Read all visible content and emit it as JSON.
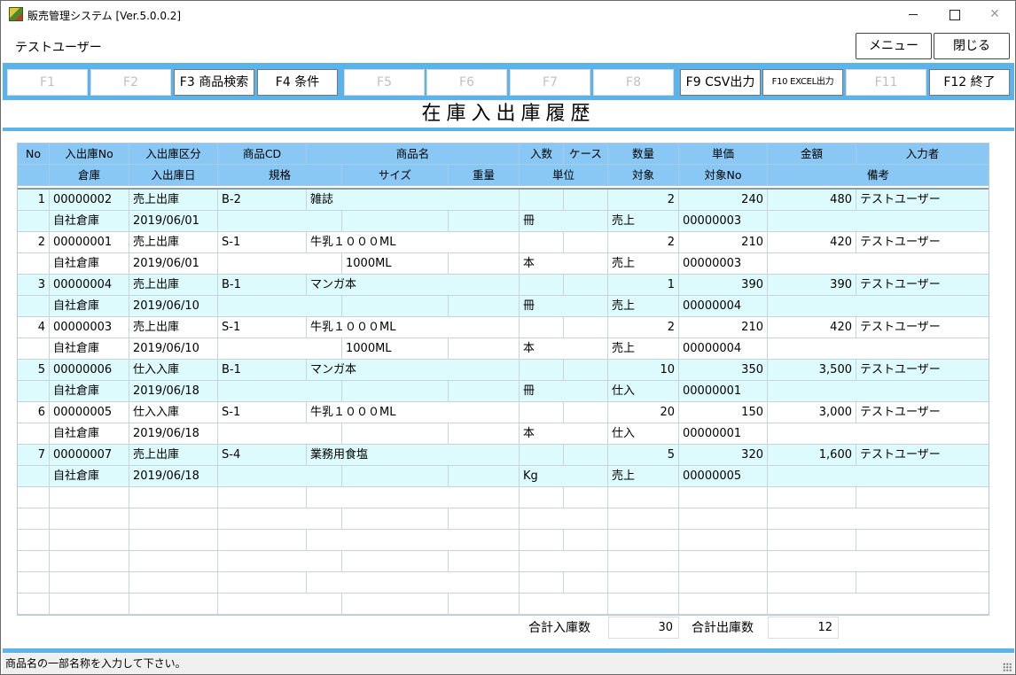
{
  "window": {
    "title": "販売管理システム [Ver.5.0.0.2]",
    "min_glyph": "",
    "max_glyph": "",
    "close_glyph": "✕"
  },
  "user": {
    "name": "テストユーザー"
  },
  "top_buttons": {
    "menu": "メニュー",
    "close": "閉じる"
  },
  "fkeys": [
    {
      "label": "F1",
      "enabled": false
    },
    {
      "label": "F2",
      "enabled": false
    },
    {
      "label": "F3 商品検索",
      "enabled": true
    },
    {
      "label": "F4 条件",
      "enabled": true
    },
    {
      "label": "F5",
      "enabled": false
    },
    {
      "label": "F6",
      "enabled": false
    },
    {
      "label": "F7",
      "enabled": false
    },
    {
      "label": "F8",
      "enabled": false
    },
    {
      "label": "F9 CSV出力",
      "enabled": true
    },
    {
      "label": "F10 EXCEL出力",
      "enabled": true
    },
    {
      "label": "F11",
      "enabled": false
    },
    {
      "label": "F12 終了",
      "enabled": true
    }
  ],
  "page_title": "在庫入出庫履歴",
  "grid": {
    "header_row1": [
      "No",
      "入出庫No",
      "入出庫区分",
      "商品CD",
      "商品名",
      "入数",
      "ケース",
      "数量",
      "単価",
      "金額",
      "入力者"
    ],
    "header_row2": [
      "倉庫",
      "入出庫日",
      "規格",
      "サイズ",
      "重量",
      "単位",
      "対象",
      "対象No",
      "備考"
    ],
    "records": [
      {
        "no": "1",
        "io_no": "00000002",
        "kubun": "売上出庫",
        "cd": "B-2",
        "name": "雑誌",
        "irisu": "",
        "case": "",
        "qty": "2",
        "price": "240",
        "amount": "480",
        "user": "テストユーザー",
        "warehouse": "自社倉庫",
        "date": "2019/06/01",
        "spec": "",
        "size": "",
        "weight": "",
        "unit": "冊",
        "target": "売上",
        "target_no": "00000003",
        "note": ""
      },
      {
        "no": "2",
        "io_no": "00000001",
        "kubun": "売上出庫",
        "cd": "S-1",
        "name": "牛乳１０００ML",
        "irisu": "",
        "case": "",
        "qty": "2",
        "price": "210",
        "amount": "420",
        "user": "テストユーザー",
        "warehouse": "自社倉庫",
        "date": "2019/06/01",
        "spec": "",
        "size": "1000ML",
        "weight": "",
        "unit": "本",
        "target": "売上",
        "target_no": "00000003",
        "note": ""
      },
      {
        "no": "3",
        "io_no": "00000004",
        "kubun": "売上出庫",
        "cd": "B-1",
        "name": "マンガ本",
        "irisu": "",
        "case": "",
        "qty": "1",
        "price": "390",
        "amount": "390",
        "user": "テストユーザー",
        "warehouse": "自社倉庫",
        "date": "2019/06/10",
        "spec": "",
        "size": "",
        "weight": "",
        "unit": "冊",
        "target": "売上",
        "target_no": "00000004",
        "note": ""
      },
      {
        "no": "4",
        "io_no": "00000003",
        "kubun": "売上出庫",
        "cd": "S-1",
        "name": "牛乳１０００ML",
        "irisu": "",
        "case": "",
        "qty": "2",
        "price": "210",
        "amount": "420",
        "user": "テストユーザー",
        "warehouse": "自社倉庫",
        "date": "2019/06/10",
        "spec": "",
        "size": "1000ML",
        "weight": "",
        "unit": "本",
        "target": "売上",
        "target_no": "00000004",
        "note": ""
      },
      {
        "no": "5",
        "io_no": "00000006",
        "kubun": "仕入入庫",
        "cd": "B-1",
        "name": "マンガ本",
        "irisu": "",
        "case": "",
        "qty": "10",
        "price": "350",
        "amount": "3,500",
        "user": "テストユーザー",
        "warehouse": "自社倉庫",
        "date": "2019/06/18",
        "spec": "",
        "size": "",
        "weight": "",
        "unit": "冊",
        "target": "仕入",
        "target_no": "00000001",
        "note": ""
      },
      {
        "no": "6",
        "io_no": "00000005",
        "kubun": "仕入入庫",
        "cd": "S-1",
        "name": "牛乳１０００ML",
        "irisu": "",
        "case": "",
        "qty": "20",
        "price": "150",
        "amount": "3,000",
        "user": "テストユーザー",
        "warehouse": "自社倉庫",
        "date": "2019/06/18",
        "spec": "",
        "size": "",
        "weight": "",
        "unit": "本",
        "target": "仕入",
        "target_no": "00000001",
        "note": ""
      },
      {
        "no": "7",
        "io_no": "00000007",
        "kubun": "売上出庫",
        "cd": "S-4",
        "name": "業務用食塩",
        "irisu": "",
        "case": "",
        "qty": "5",
        "price": "320",
        "amount": "1,600",
        "user": "テストユーザー",
        "warehouse": "自社倉庫",
        "date": "2019/06/18",
        "spec": "",
        "size": "",
        "weight": "",
        "unit": "Kg",
        "target": "売上",
        "target_no": "00000005",
        "note": ""
      }
    ],
    "empty_record_pairs": 3
  },
  "totals": {
    "in_label": "合計入庫数",
    "in_value": "30",
    "out_label": "合計出庫数",
    "out_value": "12"
  },
  "status_bar": {
    "message": "商品名の一部名称を入力して下さい。"
  }
}
